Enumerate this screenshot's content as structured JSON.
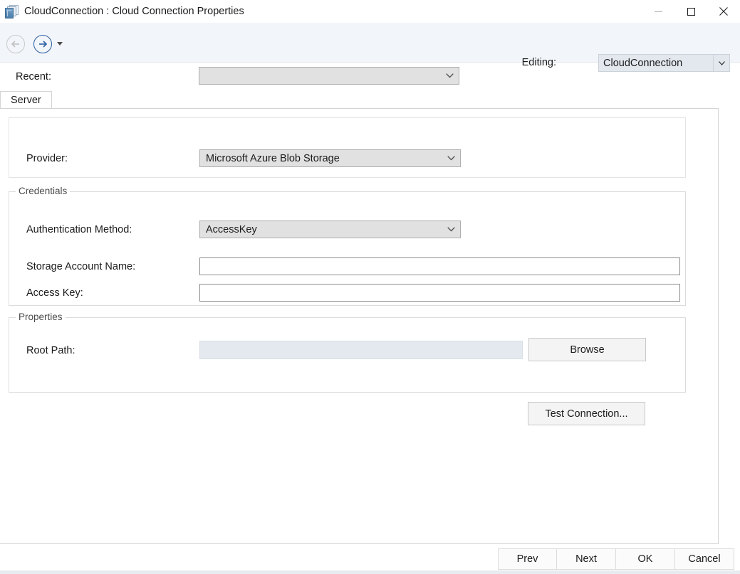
{
  "window": {
    "title": "CloudConnection : Cloud Connection Properties",
    "icon": "cloud-connection-icon",
    "controls": {
      "minimize": "minimize-icon",
      "maximize": "maximize-icon",
      "close": "close-icon"
    }
  },
  "toolbar": {
    "back_icon": "back-arrow-icon",
    "back_enabled": false,
    "forward_icon": "forward-arrow-icon",
    "forward_enabled": true,
    "dropdown_icon": "chevron-down-icon",
    "editing_label": "Editing:",
    "editing_value": "CloudConnection"
  },
  "recent": {
    "label": "Recent:",
    "value": "",
    "placeholder": ""
  },
  "tabs": [
    {
      "label": "Server",
      "selected": true
    }
  ],
  "provider": {
    "label": "Provider:",
    "value": "Microsoft Azure Blob Storage"
  },
  "credentials": {
    "legend": "Credentials",
    "auth_method": {
      "label": "Authentication Method:",
      "value": "AccessKey"
    },
    "storage_account_name": {
      "label": "Storage Account Name:",
      "value": "",
      "placeholder": ""
    },
    "access_key": {
      "label": "Access Key:",
      "value": "",
      "placeholder": ""
    }
  },
  "properties": {
    "legend": "Properties",
    "root_path": {
      "label": "Root Path:",
      "value": "",
      "placeholder": "",
      "enabled": false
    },
    "browse_button": "Browse"
  },
  "test_connection_button": "Test Connection...",
  "footer": {
    "buttons": [
      "Prev",
      "Next",
      "OK",
      "Cancel"
    ]
  },
  "colors": {
    "toolbar_background": "#f2f5f9",
    "combo_background": "#e1e1e1",
    "disabled_field_background": "#e3e9ef",
    "forward_arrow_accent": "#2a5fa3",
    "panel_border": "#d4d4d4"
  }
}
